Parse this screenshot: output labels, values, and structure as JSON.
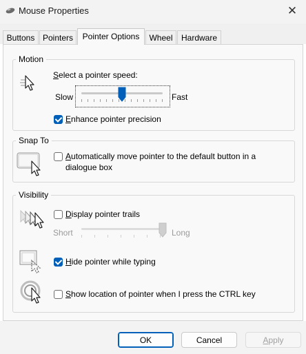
{
  "window": {
    "title": "Mouse Properties"
  },
  "tabs": [
    {
      "label": "Buttons",
      "active": false
    },
    {
      "label": "Pointers",
      "active": false
    },
    {
      "label": "Pointer Options",
      "active": true
    },
    {
      "label": "Wheel",
      "active": false
    },
    {
      "label": "Hardware",
      "active": false
    }
  ],
  "motion": {
    "group_label": "Motion",
    "speed_label": "Select a pointer speed:",
    "slow_label": "Slow",
    "fast_label": "Fast",
    "speed_value": 0.5,
    "enhance_label": "Enhance pointer precision",
    "enhance_checked": true
  },
  "snap_to": {
    "group_label": "Snap To",
    "snap_line1": "Automatically move pointer to the default button in a",
    "snap_line2": "dialogue box",
    "snap_checked": false
  },
  "visibility": {
    "group_label": "Visibility",
    "trails_label": "Display pointer trails",
    "trails_checked": false,
    "short_label": "Short",
    "long_label": "Long",
    "trail_value": 1.0,
    "hide_label": "Hide pointer while typing",
    "hide_checked": true,
    "show_location_label": "Show location of pointer when I press the CTRL key",
    "show_location_checked": false
  },
  "footer": {
    "ok_label": "OK",
    "cancel_label": "Cancel",
    "apply_label": "Apply"
  },
  "icons": {
    "title": "mouse-icon",
    "close": "close-icon",
    "motion": "pointer-speed-icon",
    "snap": "snap-to-default-button-icon",
    "trails": "pointer-trails-icon",
    "hide": "hide-pointer-icon",
    "location": "pointer-location-icon"
  },
  "colors": {
    "accent": "#005fb8",
    "panel_bg": "#f9f9f9",
    "window_bg": "#f3f3f3"
  }
}
